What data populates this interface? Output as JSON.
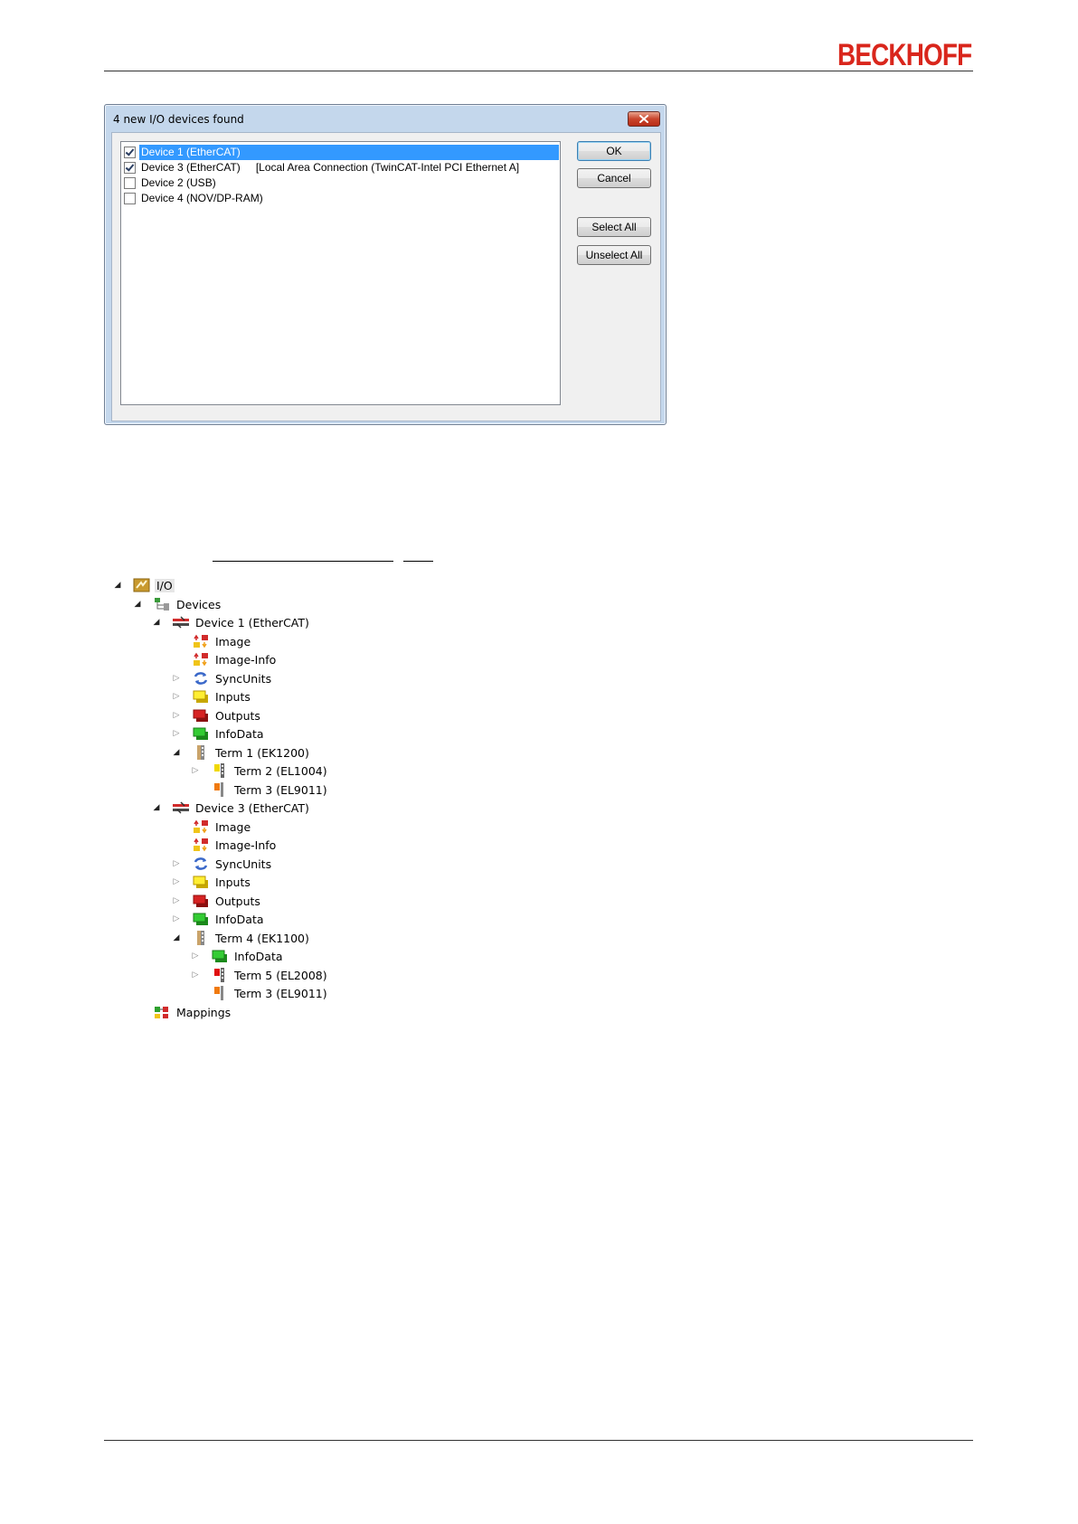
{
  "header": {
    "logo": "BECKHOFF"
  },
  "dialog": {
    "title": "4 new I/O devices found",
    "items": [
      {
        "checked": true,
        "label": "Device 1 (EtherCAT)",
        "detail": "",
        "selected": true
      },
      {
        "checked": true,
        "label": "Device 3 (EtherCAT)",
        "detail": "[Local Area Connection (TwinCAT-Intel PCI Ethernet A]",
        "selected": false
      },
      {
        "checked": false,
        "label": "Device 2 (USB)",
        "detail": "",
        "selected": false
      },
      {
        "checked": false,
        "label": "Device 4 (NOV/DP-RAM)",
        "detail": "",
        "selected": false
      }
    ],
    "buttons": {
      "ok": "OK",
      "cancel": "Cancel",
      "select_all": "Select All",
      "unselect_all": "Unselect All"
    }
  },
  "tree": [
    {
      "label": "I/O",
      "icon": "io-folder-icon",
      "toggle": "open"
    },
    {
      "label": "Devices",
      "icon": "devices-icon",
      "toggle": "open"
    },
    {
      "label": "Device 1 (EtherCAT)",
      "icon": "ethercat-device-icon",
      "toggle": "open"
    },
    {
      "label": "Image",
      "icon": "image-icon",
      "toggle": "none"
    },
    {
      "label": "Image-Info",
      "icon": "image-info-icon",
      "toggle": "none"
    },
    {
      "label": "SyncUnits",
      "icon": "syncunits-icon",
      "toggle": "closed"
    },
    {
      "label": "Inputs",
      "icon": "inputs-icon",
      "toggle": "closed"
    },
    {
      "label": "Outputs",
      "icon": "outputs-icon",
      "toggle": "closed"
    },
    {
      "label": "InfoData",
      "icon": "infodata-icon",
      "toggle": "closed"
    },
    {
      "label": "Term 1 (EK1200)",
      "icon": "coupler-icon",
      "toggle": "open"
    },
    {
      "label": "Term 2 (EL1004)",
      "icon": "input-terminal-icon",
      "toggle": "closed"
    },
    {
      "label": "Term 3 (EL9011)",
      "icon": "end-terminal-icon",
      "toggle": "none"
    },
    {
      "label": "Device 3 (EtherCAT)",
      "icon": "ethercat-device-icon",
      "toggle": "open"
    },
    {
      "label": "Image",
      "icon": "image-icon",
      "toggle": "none"
    },
    {
      "label": "Image-Info",
      "icon": "image-info-icon",
      "toggle": "none"
    },
    {
      "label": "SyncUnits",
      "icon": "syncunits-icon",
      "toggle": "closed"
    },
    {
      "label": "Inputs",
      "icon": "inputs-icon",
      "toggle": "closed"
    },
    {
      "label": "Outputs",
      "icon": "outputs-icon",
      "toggle": "closed"
    },
    {
      "label": "InfoData",
      "icon": "infodata-icon",
      "toggle": "closed"
    },
    {
      "label": "Term 4 (EK1100)",
      "icon": "coupler-icon",
      "toggle": "open"
    },
    {
      "label": "InfoData",
      "icon": "infodata-icon",
      "toggle": "closed"
    },
    {
      "label": "Term 5 (EL2008)",
      "icon": "output-terminal-icon",
      "toggle": "closed"
    },
    {
      "label": "Term 3 (EL9011)",
      "icon": "end-terminal-icon",
      "toggle": "none"
    },
    {
      "label": "Mappings",
      "icon": "mappings-icon",
      "toggle": "none"
    }
  ]
}
